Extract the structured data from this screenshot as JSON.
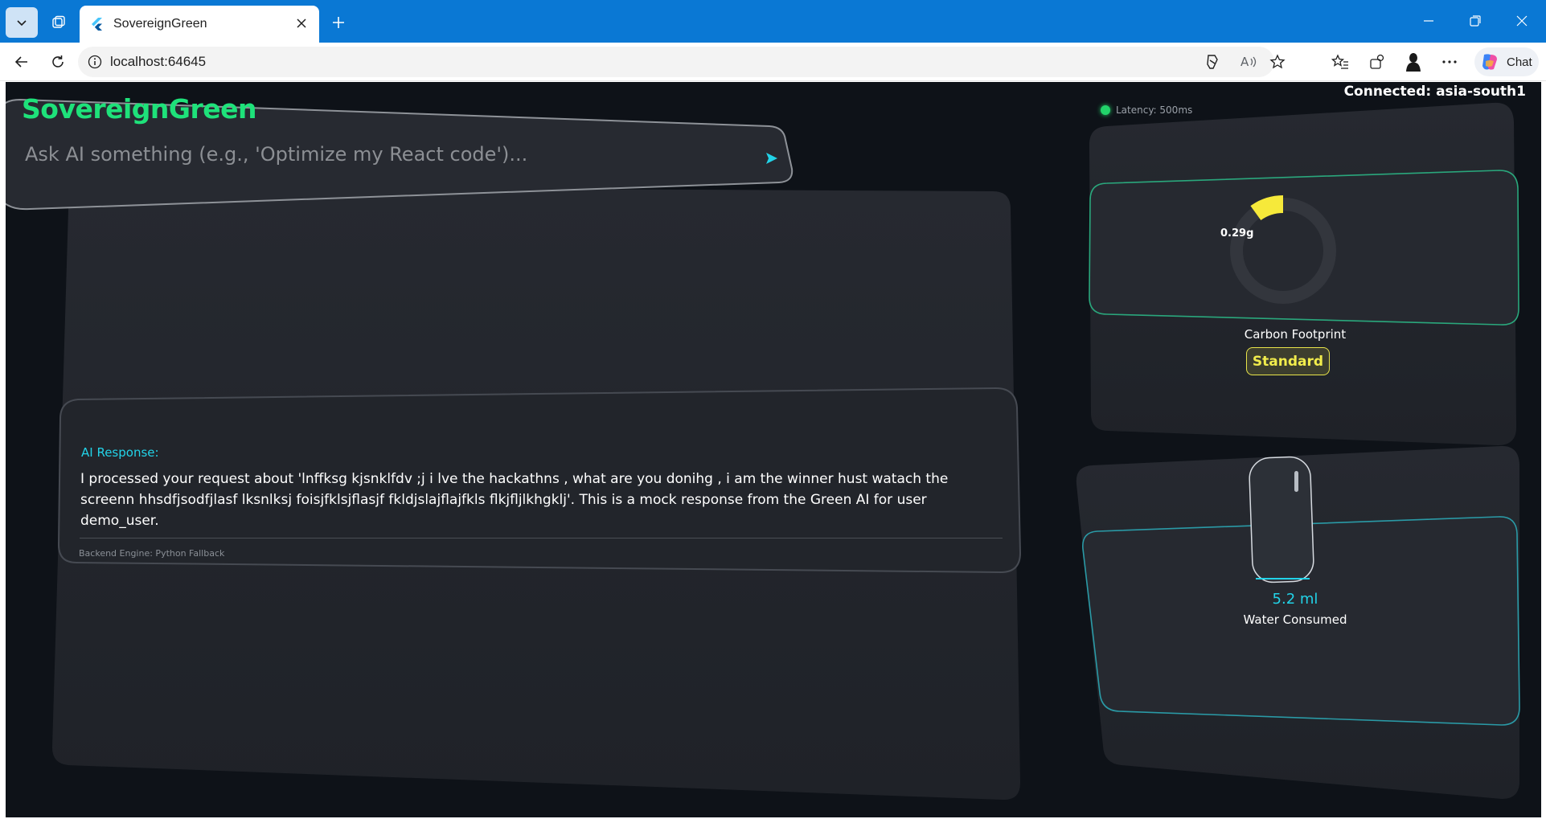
{
  "browser": {
    "tab_title": "SovereignGreen",
    "address": "localhost:64645",
    "chat_label": "Chat",
    "icons": [
      "tab-actions-icon",
      "workspaces-icon",
      "flutter-icon",
      "close-icon",
      "plus-icon",
      "minimize-icon",
      "restore-icon",
      "close-window-icon",
      "back-icon",
      "refresh-icon",
      "info-icon",
      "copilot-icon",
      "read-aloud-icon",
      "favorite-star-icon",
      "favorites-icon",
      "extensions-icon",
      "profile-icon",
      "more-icon"
    ]
  },
  "app": {
    "brand": "SovereignGreen",
    "connection": "Connected: asia-south1",
    "latency": "Latency: 500ms",
    "search_placeholder": "Ask AI something (e.g., 'Optimize my React code')...",
    "response": {
      "title": "AI Response:",
      "text": "I processed your request about 'lnffksg kjsnklfdv ;j i lve the hackathns , what are you donihg , i am the winner hust watach the screenn hhsdfjsodfjlasf lksnlksj foisjfklsjflasjf fkldjslajflajfkls flkjfljlkhgklj'. This is a mock response from the Green AI for user demo_user.",
      "engine": "Backend Engine: Python Fallback"
    },
    "carbon": {
      "value": "0.29g",
      "label": "Carbon Footprint",
      "badge": "Standard",
      "gauge_fraction": 0.1,
      "gauge_color": "#f6e93a"
    },
    "water": {
      "value": "5.2 ml",
      "label": "Water Consumed",
      "icon": "water-bottle-icon"
    },
    "colors": {
      "accent_green": "#1ee27a",
      "accent_cyan": "#22d3e8",
      "badge_yellow": "#f1ec4c",
      "background": "#0e1218",
      "card": "#23262d"
    }
  }
}
